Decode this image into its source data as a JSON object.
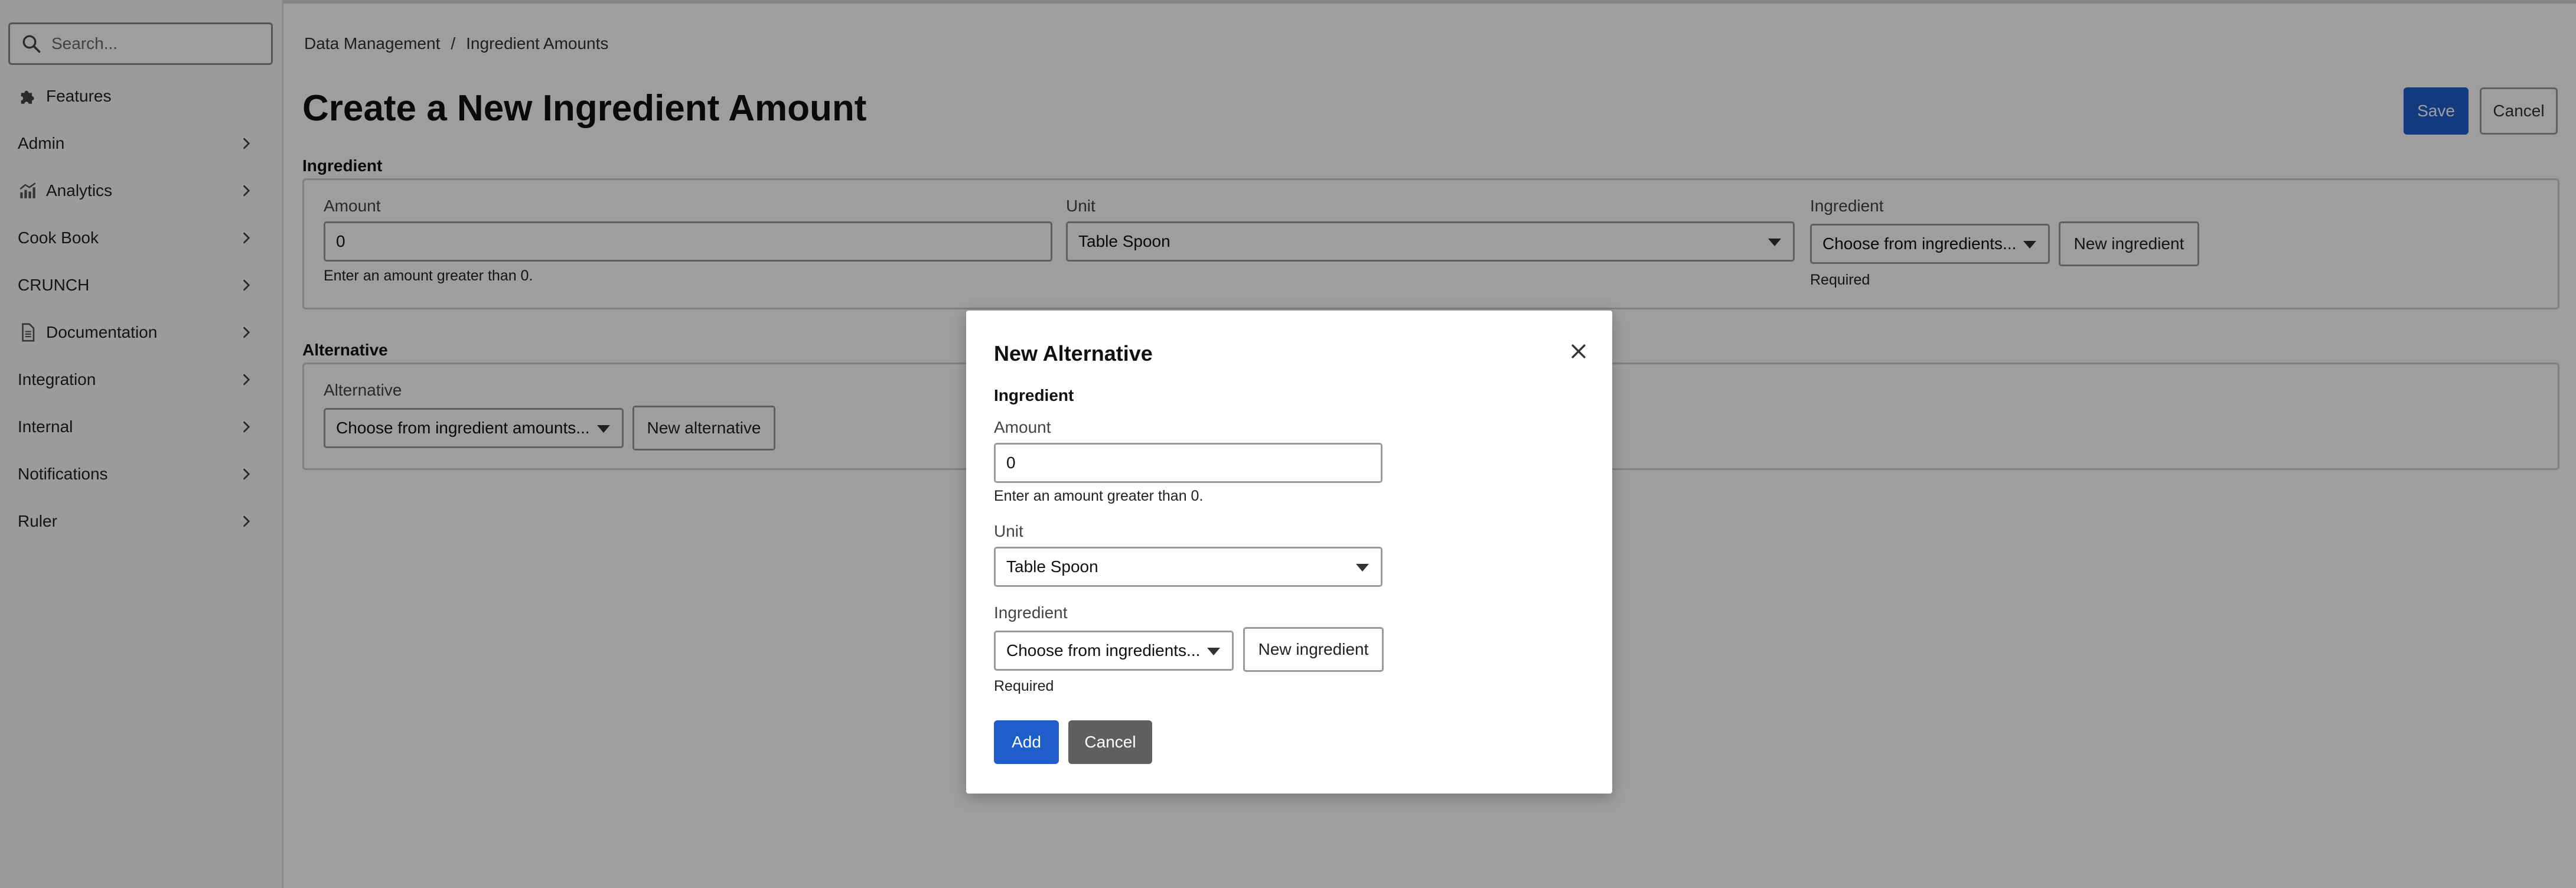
{
  "sidebar": {
    "search_placeholder": "Search...",
    "items": [
      {
        "label": "Features",
        "icon": "puzzle-icon",
        "has_chevron": false
      },
      {
        "label": "Admin",
        "icon": null,
        "has_chevron": true
      },
      {
        "label": "Analytics",
        "icon": "analytics-chart-icon",
        "has_chevron": true
      },
      {
        "label": "Cook Book",
        "icon": null,
        "has_chevron": true
      },
      {
        "label": "CRUNCH",
        "icon": null,
        "has_chevron": true
      },
      {
        "label": "Documentation",
        "icon": "document-icon",
        "has_chevron": true
      },
      {
        "label": "Integration",
        "icon": null,
        "has_chevron": true
      },
      {
        "label": "Internal",
        "icon": null,
        "has_chevron": true
      },
      {
        "label": "Notifications",
        "icon": null,
        "has_chevron": true
      },
      {
        "label": "Ruler",
        "icon": null,
        "has_chevron": true
      }
    ]
  },
  "breadcrumb": {
    "items": [
      "Data Management",
      "Ingredient Amounts"
    ],
    "separator": "/"
  },
  "page": {
    "title": "Create a New Ingredient Amount",
    "save_label": "Save",
    "cancel_label": "Cancel"
  },
  "ingredient_section": {
    "label": "Ingredient",
    "amount_label": "Amount",
    "amount_value": "0",
    "amount_help": "Enter an amount greater than 0.",
    "unit_label": "Unit",
    "unit_value": "Table Spoon",
    "ingredient_label": "Ingredient",
    "ingredient_placeholder": "Choose from ingredients...",
    "new_ingredient_label": "New ingredient",
    "required_text": "Required"
  },
  "alternative_section": {
    "label": "Alternative",
    "field_label": "Alternative",
    "select_placeholder": "Choose from ingredient amounts...",
    "new_alternative_label": "New alternative"
  },
  "modal": {
    "title": "New Alternative",
    "section_label": "Ingredient",
    "amount_label": "Amount",
    "amount_value": "0",
    "amount_help": "Enter an amount greater than 0.",
    "unit_label": "Unit",
    "unit_value": "Table Spoon",
    "ingredient_label": "Ingredient",
    "ingredient_placeholder": "Choose from ingredients...",
    "new_ingredient_label": "New ingredient",
    "required_text": "Required",
    "add_label": "Add",
    "cancel_label": "Cancel"
  },
  "colors": {
    "primary": "#1f5ccc",
    "secondary_button": "#5f5f5f",
    "overlay": "rgba(0,0,0,0.38)"
  }
}
